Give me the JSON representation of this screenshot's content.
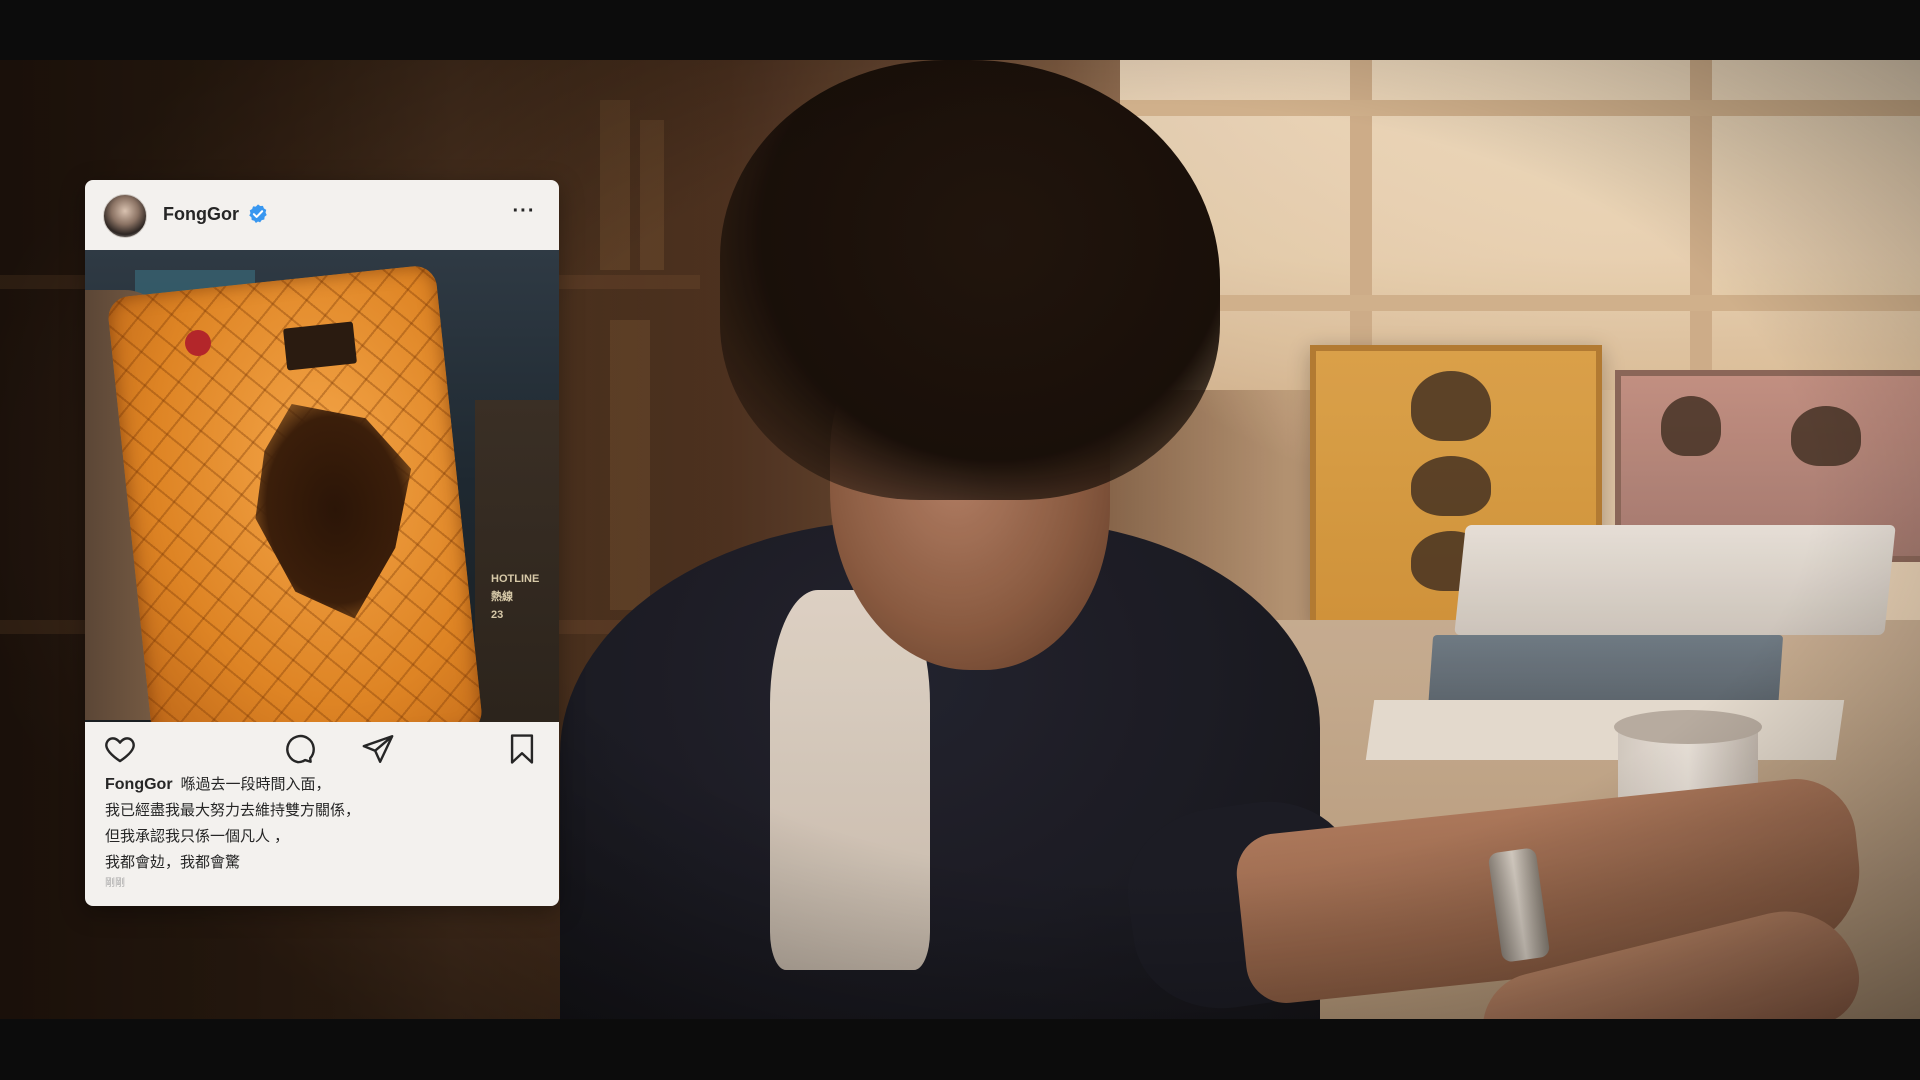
{
  "post": {
    "header": {
      "username": "FongGor",
      "verified": true,
      "more_label": "···"
    },
    "photo": {
      "subject": "torn orange mattress",
      "sign_lines": [
        "HOTLINE",
        "熱線",
        "23"
      ]
    },
    "actions": {
      "like_icon": "heart-icon",
      "comment_icon": "comment-icon",
      "share_icon": "send-icon",
      "save_icon": "bookmark-icon"
    },
    "caption": {
      "username": "FongGor",
      "lines": [
        "喺過去一段時間入面，",
        "我已經盡我最大努力去維持雙方關係，",
        "但我承認我只係一個凡人 ，",
        "我都會攰，我都會驚"
      ]
    },
    "timestamp": "剛剛"
  },
  "colors": {
    "accent_verified": "#3897f0",
    "card_bg": "#f3f1ee",
    "text": "#262626"
  }
}
